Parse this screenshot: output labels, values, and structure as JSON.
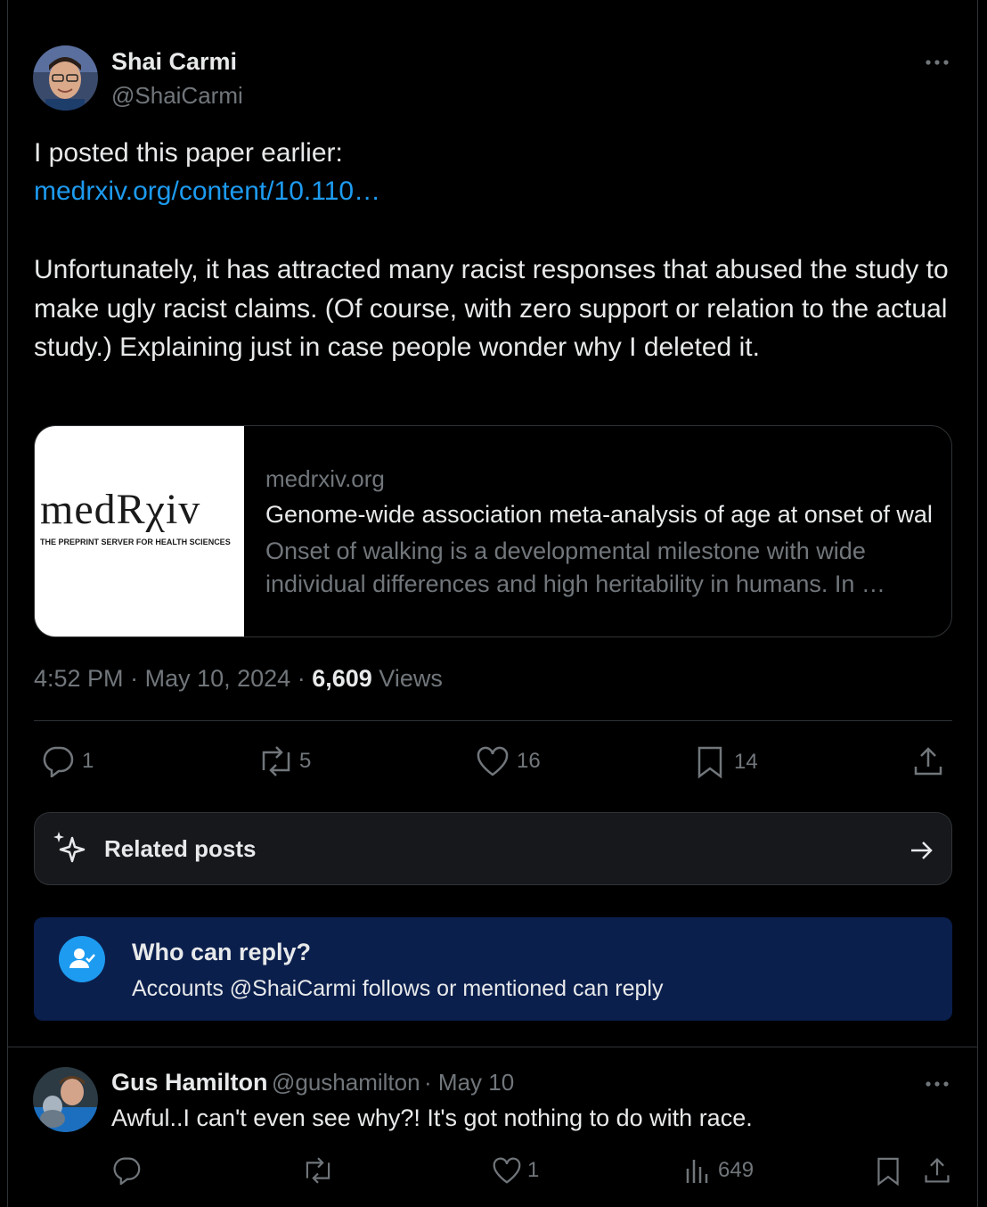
{
  "main_tweet": {
    "author_name": "Shai Carmi",
    "author_handle": "@ShaiCarmi",
    "text_intro": "I posted this paper earlier:",
    "link_text": "medrxiv.org/content/10.110…",
    "text_body": "Unfortunately, it has attracted many racist responses that abused the study to make ugly racist claims. (Of course, with zero support or relation to the actual study.) Explaining just in case people wonder why I deleted it.",
    "card": {
      "logo_text": "medRχiv",
      "logo_tagline": "THE PREPRINT SERVER FOR HEALTH SCIENCES",
      "domain": "medrxiv.org",
      "title": "Genome-wide association meta-analysis of age at onset of walking",
      "description": "Onset of walking is a developmental milestone with wide individual differences and high heritability in humans. In …"
    },
    "time": "4:52 PM",
    "date": "May 10, 2024",
    "views_count": "6,609",
    "views_label": "Views",
    "actions": {
      "replies": "1",
      "reposts": "5",
      "likes": "16",
      "bookmarks": "14"
    }
  },
  "related_posts": {
    "label": "Related posts"
  },
  "who_can_reply": {
    "title": "Who can reply?",
    "subtitle": "Accounts @ShaiCarmi follows or mentioned can reply"
  },
  "reply_tweet": {
    "author_name": "Gus Hamilton",
    "author_handle": "@gushamilton",
    "date": "May 10",
    "text": "Awful..I can't even see why?! It's got nothing to do with race.",
    "actions": {
      "likes": "1",
      "views": "649"
    }
  },
  "icons": [
    "more-icon",
    "reply-icon",
    "repost-icon",
    "like-icon",
    "bookmark-icon",
    "share-icon",
    "sparkle-icon",
    "arrow-right-icon",
    "person-check-icon",
    "views-icon"
  ],
  "colors": {
    "background": "#000000",
    "link": "#1d9bf0",
    "secondary_text": "#71767b",
    "who_can_reply_bg": "#0b1f4d"
  }
}
